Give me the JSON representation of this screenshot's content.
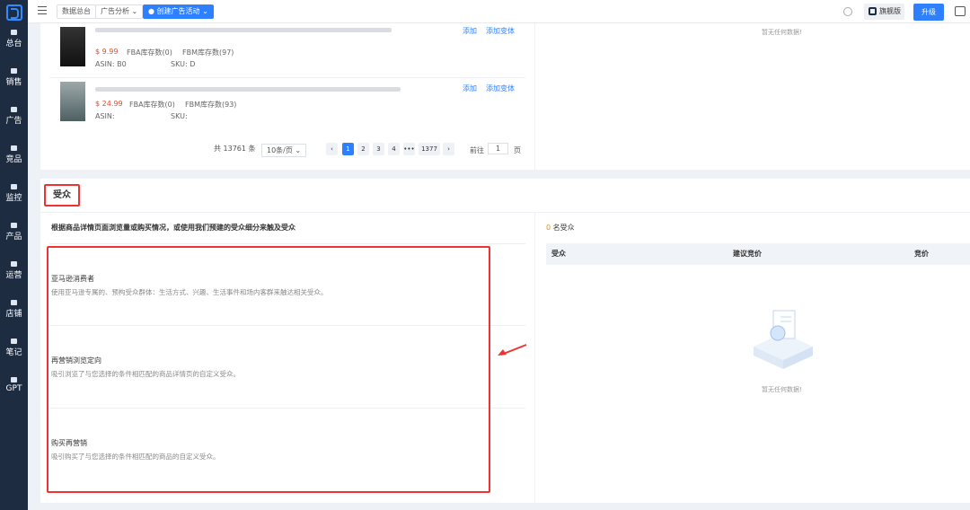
{
  "sidebar": {
    "items": [
      {
        "label": "总台"
      },
      {
        "label": "销售"
      },
      {
        "label": "广告"
      },
      {
        "label": "竞品"
      },
      {
        "label": "监控"
      },
      {
        "label": "产品"
      },
      {
        "label": "运营"
      },
      {
        "label": "店铺"
      },
      {
        "label": "笔记"
      },
      {
        "label": "GPT"
      }
    ]
  },
  "topbar": {
    "tabs": [
      "数据总台",
      "广告分析 ⌄",
      "● 创建广告活动 ⌄"
    ],
    "flag": "旗舰版",
    "upgrade": "升级"
  },
  "products": [
    {
      "price": "$ 9.99",
      "fba": "FBA库存数(0)",
      "fbm": "FBM库存数(97)",
      "asin": "ASIN: B0",
      "sku": "SKU: D",
      "add": "添加",
      "variant": "添加变体"
    },
    {
      "price": "$ 24.99",
      "fba": "FBA库存数(0)",
      "fbm": "FBM库存数(93)",
      "asin": "ASIN:",
      "sku": "SKU:",
      "add": "添加",
      "variant": "添加变体"
    }
  ],
  "pager": {
    "total": "共 13761 条",
    "size": "10条/页 ⌄",
    "pages": [
      "1",
      "2",
      "3",
      "4",
      "•••",
      "1377"
    ],
    "goto": "前往",
    "page": "1",
    "unit": "页"
  },
  "right_empty_top": "暂无任何数据!",
  "section_title": "受众",
  "intro": "根据商品详情页面浏览量或购买情况，或使用我们预建的受众细分来触及受众",
  "audiences": [
    {
      "title": "亚马逊消费者",
      "desc": "使用亚马逊专属的、预构受众群体：生活方式、兴趣、生活事件和场内客群来触达相关受众。"
    },
    {
      "title": "再营销浏览定向",
      "desc": "吸引浏览了与您选择的条件相匹配的商品详情页的自定义受众。"
    },
    {
      "title": "购买再营销",
      "desc": "吸引购买了与您选择的条件相匹配的商品的自定义受众。"
    }
  ],
  "audience_count": {
    "num": "0",
    "label": "名受众"
  },
  "table_headers": [
    "受众",
    "建议竞价",
    "竞价"
  ],
  "empty_text": "暂无任何数据!",
  "colors": {
    "accent": "#2f80ff",
    "sidebar": "#1e2c42",
    "highlight": "#e33333",
    "price": "#e24b2c"
  }
}
